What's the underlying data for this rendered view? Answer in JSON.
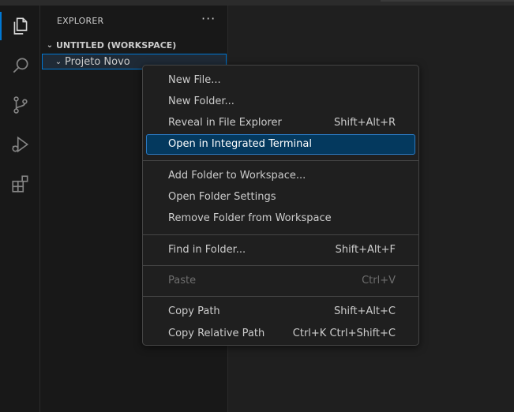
{
  "explorer": {
    "title": "EXPLORER",
    "more": "···",
    "workspace_label": "UNTITLED (WORKSPACE)",
    "folder_name": "Projeto Novo"
  },
  "activity_bar": [
    {
      "icon": "files-icon",
      "active": true
    },
    {
      "icon": "search-icon"
    },
    {
      "icon": "source-control-icon"
    },
    {
      "icon": "run-debug-icon"
    },
    {
      "icon": "extensions-icon"
    }
  ],
  "context_menu": {
    "groups": [
      [
        {
          "label": "New File...",
          "shortcut": ""
        },
        {
          "label": "New Folder...",
          "shortcut": ""
        },
        {
          "label": "Reveal in File Explorer",
          "shortcut": "Shift+Alt+R"
        },
        {
          "label": "Open in Integrated Terminal",
          "shortcut": "",
          "highlighted": true
        }
      ],
      [
        {
          "label": "Add Folder to Workspace...",
          "shortcut": ""
        },
        {
          "label": "Open Folder Settings",
          "shortcut": ""
        },
        {
          "label": "Remove Folder from Workspace",
          "shortcut": ""
        }
      ],
      [
        {
          "label": "Find in Folder...",
          "shortcut": "Shift+Alt+F"
        }
      ],
      [
        {
          "label": "Paste",
          "shortcut": "Ctrl+V",
          "disabled": true
        }
      ],
      [
        {
          "label": "Copy Path",
          "shortcut": "Shift+Alt+C"
        },
        {
          "label": "Copy Relative Path",
          "shortcut": "Ctrl+K Ctrl+Shift+C"
        }
      ]
    ]
  },
  "colors": {
    "accent": "#0078d4",
    "menu_highlight": "#04395e",
    "background": "#1f1f1f",
    "sidebar": "#181818"
  }
}
